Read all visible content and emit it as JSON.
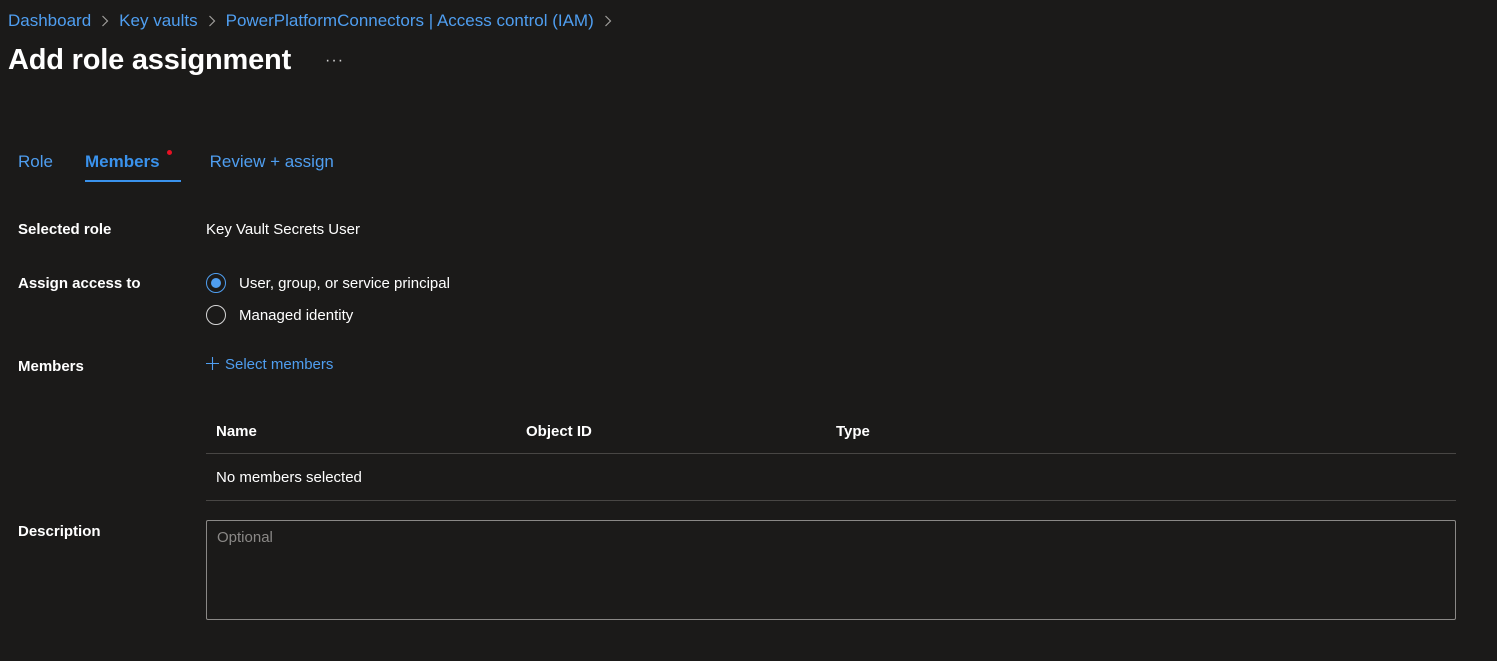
{
  "breadcrumb": {
    "items": [
      {
        "label": "Dashboard"
      },
      {
        "label": "Key vaults"
      },
      {
        "label": "PowerPlatformConnectors | Access control (IAM)"
      }
    ]
  },
  "header": {
    "title": "Add role assignment",
    "more_label": "···"
  },
  "tabs": [
    {
      "label": "Role",
      "active": false
    },
    {
      "label": "Members",
      "active": true,
      "required_indicator": true
    },
    {
      "label": "Review + assign",
      "active": false
    }
  ],
  "form": {
    "selected_role": {
      "label": "Selected role",
      "value": "Key Vault Secrets User"
    },
    "assign_access": {
      "label": "Assign access to",
      "options": [
        {
          "label": "User, group, or service principal",
          "checked": true
        },
        {
          "label": "Managed identity",
          "checked": false
        }
      ]
    },
    "members": {
      "label": "Members",
      "select_label": "Select members",
      "table": {
        "columns": [
          "Name",
          "Object ID",
          "Type"
        ],
        "empty_text": "No members selected"
      }
    },
    "description": {
      "label": "Description",
      "placeholder": "Optional",
      "value": ""
    }
  },
  "colors": {
    "background": "#1b1a19",
    "link": "#4f9ef0",
    "accent": "#3a92ec",
    "required": "#e81123"
  }
}
